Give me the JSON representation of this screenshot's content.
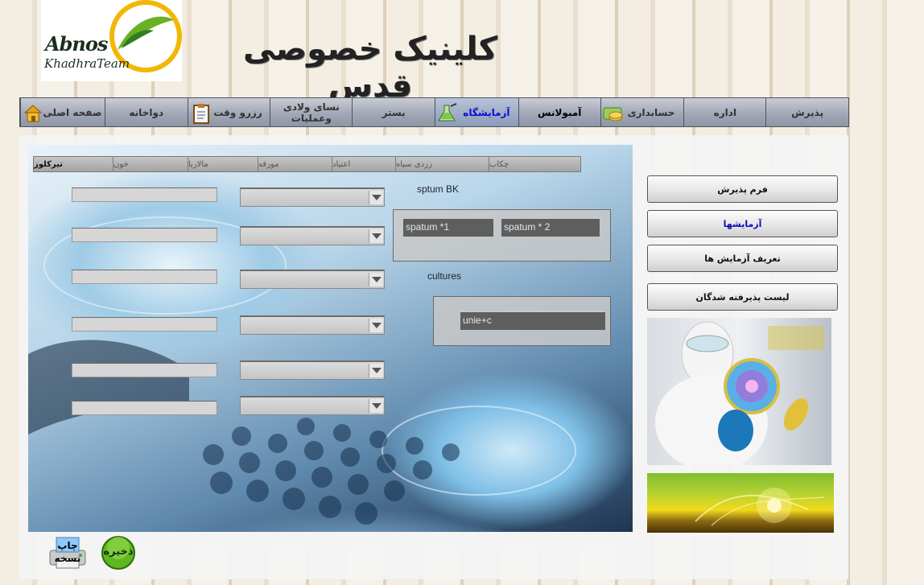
{
  "header": {
    "logo_text_1": "Abnos",
    "logo_text_2": "KhadhraTeam",
    "site_title": "کلینیک خصوصی قدس"
  },
  "nav": {
    "items": [
      {
        "label": "پذیرش"
      },
      {
        "label": "اداره"
      },
      {
        "label": "حسابداری",
        "icon": "coins-icon"
      },
      {
        "label": "آمبولانس"
      },
      {
        "label": "آزمایشگاه",
        "icon": "flask-icon"
      },
      {
        "label": "بستر"
      },
      {
        "label": "نسای ولادی وعملیات"
      },
      {
        "label": "رزرو وقت",
        "icon": "clipboard-icon"
      },
      {
        "label": "دواخانه"
      },
      {
        "label": "صفحه اصلی",
        "icon": "home-icon"
      }
    ]
  },
  "lab_tabs": [
    {
      "label": "چکاب"
    },
    {
      "label": "زردی سیاه"
    },
    {
      "label": "اعتیاد"
    },
    {
      "label": "مورقه"
    },
    {
      "label": "مالاریا"
    },
    {
      "label": "خون"
    },
    {
      "label": "تیرکلوز"
    }
  ],
  "sputum": {
    "title": "sptum BK",
    "field_1": "spatum *1",
    "field_2": "spatum * 2"
  },
  "cultures": {
    "title": "cultures",
    "field_1": "unie+c"
  },
  "sidebar": {
    "buttons": [
      {
        "label": "فرم پذیرش"
      },
      {
        "label": "آزمایشها"
      },
      {
        "label": "تعریف آزمایش ها"
      },
      {
        "label": "لیست پذیرفته شدگان"
      }
    ]
  },
  "footer": {
    "print_label": "چاپ نسخه",
    "save_label": "ذخیره"
  },
  "colors": {
    "nav_active": "#0a0ad6",
    "sidebar_active": "#0b0bb8",
    "save_green": "#5fb81f"
  }
}
